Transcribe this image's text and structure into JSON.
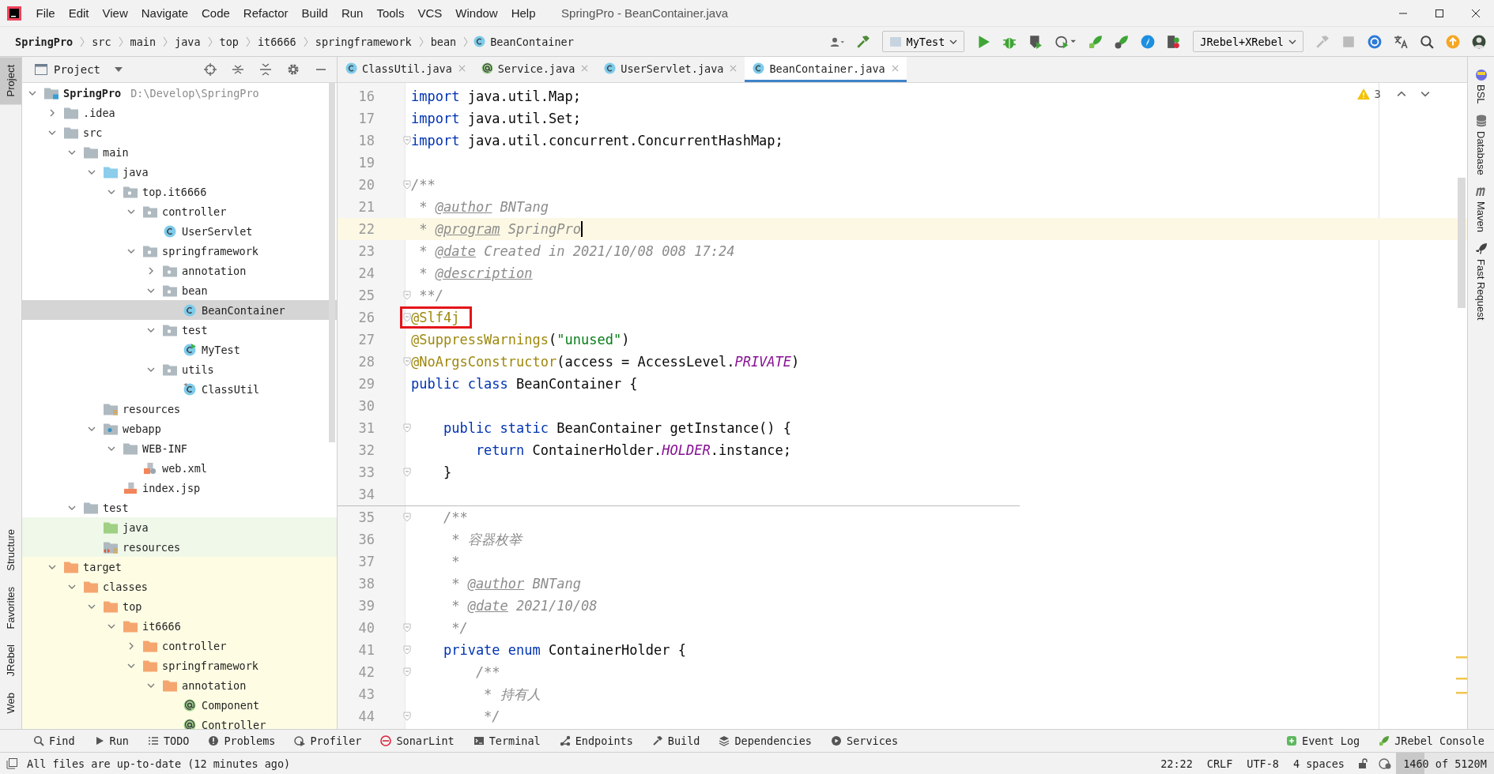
{
  "window": {
    "title": "SpringPro - BeanContainer.java"
  },
  "menu": [
    "File",
    "Edit",
    "View",
    "Navigate",
    "Code",
    "Refactor",
    "Build",
    "Run",
    "Tools",
    "VCS",
    "Window",
    "Help"
  ],
  "breadcrumbs": [
    {
      "label": "SpringPro",
      "kind": "project"
    },
    {
      "label": "src",
      "kind": "dir"
    },
    {
      "label": "main",
      "kind": "dir"
    },
    {
      "label": "java",
      "kind": "dir"
    },
    {
      "label": "top",
      "kind": "dir"
    },
    {
      "label": "it6666",
      "kind": "dir"
    },
    {
      "label": "springframework",
      "kind": "dir"
    },
    {
      "label": "bean",
      "kind": "dir"
    },
    {
      "label": "BeanContainer",
      "kind": "class"
    }
  ],
  "run_config": "MyTest",
  "rebel_config": "JRebel+XRebel",
  "left_tools": [
    {
      "label": "Project",
      "selected": true
    },
    {
      "label": "Structure",
      "selected": false
    },
    {
      "label": "Favorites",
      "selected": false
    },
    {
      "label": "JRebel",
      "selected": false
    },
    {
      "label": "Web",
      "selected": false
    }
  ],
  "right_tools": [
    "BSL",
    "Database",
    "Maven",
    "Fast Request"
  ],
  "project": {
    "title": "Project",
    "tree": [
      {
        "name": "SpringPro",
        "kind": "module",
        "hint": "D:\\Develop\\SpringPro",
        "expanded": true,
        "selected": false,
        "children": [
          {
            "name": ".idea",
            "kind": "folder",
            "expanded": false,
            "selected": false
          },
          {
            "name": "src",
            "kind": "folder",
            "expanded": true,
            "selected": false,
            "children": [
              {
                "name": "main",
                "kind": "folder",
                "expanded": true,
                "selected": false,
                "children": [
                  {
                    "name": "java",
                    "kind": "source",
                    "expanded": true,
                    "selected": false,
                    "children": [
                      {
                        "name": "top.it6666",
                        "kind": "package",
                        "expanded": true,
                        "selected": false,
                        "children": [
                          {
                            "name": "controller",
                            "kind": "package",
                            "expanded": true,
                            "selected": false,
                            "children": [
                              {
                                "name": "UserServlet",
                                "kind": "class",
                                "selected": false
                              }
                            ]
                          },
                          {
                            "name": "springframework",
                            "kind": "package",
                            "expanded": true,
                            "selected": false,
                            "children": [
                              {
                                "name": "annotation",
                                "kind": "package",
                                "expanded": false,
                                "selected": false
                              },
                              {
                                "name": "bean",
                                "kind": "package",
                                "expanded": true,
                                "selected": false,
                                "children": [
                                  {
                                    "name": "BeanContainer",
                                    "kind": "class",
                                    "selected": true
                                  }
                                ]
                              },
                              {
                                "name": "test",
                                "kind": "package",
                                "expanded": true,
                                "selected": false,
                                "children": [
                                  {
                                    "name": "MyTest",
                                    "kind": "test-class",
                                    "selected": false
                                  }
                                ]
                              },
                              {
                                "name": "utils",
                                "kind": "package",
                                "expanded": true,
                                "selected": false,
                                "children": [
                                  {
                                    "name": "ClassUtil",
                                    "kind": "util-class",
                                    "selected": false
                                  }
                                ]
                              }
                            ]
                          }
                        ]
                      }
                    ]
                  },
                  {
                    "name": "resources",
                    "kind": "resources",
                    "selected": false
                  },
                  {
                    "name": "webapp",
                    "kind": "web",
                    "expanded": true,
                    "selected": false,
                    "children": [
                      {
                        "name": "WEB-INF",
                        "kind": "folder",
                        "expanded": true,
                        "selected": false,
                        "children": [
                          {
                            "name": "web.xml",
                            "kind": "xml",
                            "selected": false
                          }
                        ]
                      },
                      {
                        "name": "index.jsp",
                        "kind": "jsp",
                        "selected": false
                      }
                    ]
                  }
                ]
              },
              {
                "name": "test",
                "kind": "folder",
                "expanded": true,
                "selected": false,
                "children": [
                  {
                    "name": "java",
                    "kind": "test-source",
                    "color": "#eff8e9",
                    "selected": false
                  },
                  {
                    "name": "resources",
                    "kind": "test-resources",
                    "color": "#eff8e9",
                    "selected": false
                  }
                ]
              }
            ]
          },
          {
            "name": "target",
            "kind": "excluded",
            "color": "#fefde4",
            "expanded": true,
            "selected": false,
            "children": [
              {
                "name": "classes",
                "kind": "excluded",
                "color": "#fefde4",
                "expanded": true,
                "selected": false,
                "children": [
                  {
                    "name": "top",
                    "kind": "excluded",
                    "color": "#fefde4",
                    "expanded": true,
                    "selected": false,
                    "children": [
                      {
                        "name": "it6666",
                        "kind": "excluded",
                        "color": "#fefde4",
                        "expanded": true,
                        "selected": false,
                        "children": [
                          {
                            "name": "controller",
                            "kind": "excluded",
                            "color": "#fefde4",
                            "expanded": false,
                            "selected": false
                          },
                          {
                            "name": "springframework",
                            "kind": "excluded",
                            "color": "#fefde4",
                            "expanded": true,
                            "selected": false,
                            "children": [
                              {
                                "name": "annotation",
                                "kind": "excluded",
                                "color": "#fefde4",
                                "expanded": true,
                                "selected": false,
                                "children": [
                                  {
                                    "name": "Component",
                                    "kind": "annotation",
                                    "color": "#fefde4",
                                    "selected": false
                                  },
                                  {
                                    "name": "Controller",
                                    "kind": "annotation",
                                    "color": "#fefde4",
                                    "selected": false
                                  }
                                ]
                              }
                            ]
                          }
                        ]
                      }
                    ]
                  }
                ]
              }
            ]
          }
        ]
      }
    ]
  },
  "tabs": [
    {
      "label": "ClassUtil.java",
      "kind": "class",
      "selected": false
    },
    {
      "label": "Service.java",
      "kind": "annotation",
      "selected": false
    },
    {
      "label": "UserServlet.java",
      "kind": "class",
      "selected": false
    },
    {
      "label": "BeanContainer.java",
      "kind": "class",
      "selected": true
    }
  ],
  "inspection": {
    "warnings": "3"
  },
  "code": {
    "lines": [
      {
        "number": "16",
        "tokens": [
          {
            "kind": "keyword",
            "text": "import"
          },
          {
            "kind": "plain",
            "text": " java.util.Map;"
          }
        ]
      },
      {
        "number": "17",
        "tokens": [
          {
            "kind": "keyword",
            "text": "import"
          },
          {
            "kind": "plain",
            "text": " java.util.Set;"
          }
        ]
      },
      {
        "number": "18",
        "fold": true,
        "tokens": [
          {
            "kind": "keyword",
            "text": "import"
          },
          {
            "kind": "plain",
            "text": " java.util.concurrent.ConcurrentHashMap;"
          }
        ]
      },
      {
        "number": "19"
      },
      {
        "number": "20",
        "fold": true,
        "tokens": [
          {
            "kind": "comment",
            "text": "/**"
          }
        ]
      },
      {
        "number": "21",
        "tokens": [
          {
            "kind": "comment",
            "text": " * "
          },
          {
            "kind": "doctag",
            "text": "@author"
          },
          {
            "kind": "comment",
            "text": " BNTang"
          }
        ]
      },
      {
        "number": "22",
        "current": true,
        "caret": true,
        "tokens": [
          {
            "kind": "comment",
            "text": " * "
          },
          {
            "kind": "doctag",
            "text": "@program"
          },
          {
            "kind": "comment",
            "text": " SpringPro"
          }
        ]
      },
      {
        "number": "23",
        "tokens": [
          {
            "kind": "comment",
            "text": " * "
          },
          {
            "kind": "doctag",
            "text": "@date"
          },
          {
            "kind": "comment",
            "text": " Created in 2021/10/08 008 17:24"
          }
        ]
      },
      {
        "number": "24",
        "tokens": [
          {
            "kind": "comment",
            "text": " * "
          },
          {
            "kind": "doctag",
            "text": "@description"
          }
        ]
      },
      {
        "number": "25",
        "fold": true,
        "tokens": [
          {
            "kind": "comment",
            "text": " **/"
          }
        ]
      },
      {
        "number": "26",
        "fold": true,
        "boxed": true,
        "tokens": [
          {
            "kind": "annotation",
            "text": "@Slf4j"
          }
        ]
      },
      {
        "number": "27",
        "tokens": [
          {
            "kind": "annotation",
            "text": "@SuppressWarnings"
          },
          {
            "kind": "plain",
            "text": "("
          },
          {
            "kind": "string",
            "text": "\"unused\""
          },
          {
            "kind": "plain",
            "text": ")"
          }
        ]
      },
      {
        "number": "28",
        "fold": true,
        "tokens": [
          {
            "kind": "annotation",
            "text": "@NoArgsConstructor"
          },
          {
            "kind": "plain",
            "text": "(access = AccessLevel."
          },
          {
            "kind": "constant",
            "text": "PRIVATE"
          },
          {
            "kind": "plain",
            "text": ")"
          }
        ]
      },
      {
        "number": "29",
        "tokens": [
          {
            "kind": "keyword",
            "text": "public class"
          },
          {
            "kind": "plain",
            "text": " BeanContainer {"
          }
        ]
      },
      {
        "number": "30"
      },
      {
        "number": "31",
        "fold": true,
        "tokens": [
          {
            "kind": "keyword",
            "text": "    public static"
          },
          {
            "kind": "plain",
            "text": " BeanContainer getInstance() {"
          }
        ]
      },
      {
        "number": "32",
        "tokens": [
          {
            "kind": "keyword",
            "text": "        return"
          },
          {
            "kind": "plain",
            "text": " ContainerHolder."
          },
          {
            "kind": "constant",
            "text": "HOLDER"
          },
          {
            "kind": "plain",
            "text": ".instance;"
          }
        ]
      },
      {
        "number": "33",
        "fold": true,
        "tokens": [
          {
            "kind": "plain",
            "text": "    }"
          }
        ]
      },
      {
        "number": "34"
      },
      {
        "number": "35",
        "fold": true,
        "separator": true,
        "tokens": [
          {
            "kind": "comment",
            "text": "    /**"
          }
        ]
      },
      {
        "number": "36",
        "tokens": [
          {
            "kind": "comment",
            "text": "     * 容器枚举"
          }
        ]
      },
      {
        "number": "37",
        "tokens": [
          {
            "kind": "comment",
            "text": "     *"
          }
        ]
      },
      {
        "number": "38",
        "tokens": [
          {
            "kind": "comment",
            "text": "     * "
          },
          {
            "kind": "doctag",
            "text": "@author"
          },
          {
            "kind": "comment",
            "text": " BNTang"
          }
        ]
      },
      {
        "number": "39",
        "tokens": [
          {
            "kind": "comment",
            "text": "     * "
          },
          {
            "kind": "doctag",
            "text": "@date"
          },
          {
            "kind": "comment",
            "text": " 2021/10/08"
          }
        ]
      },
      {
        "number": "40",
        "fold": true,
        "tokens": [
          {
            "kind": "comment",
            "text": "     */"
          }
        ]
      },
      {
        "number": "41",
        "fold": true,
        "tokens": [
          {
            "kind": "keyword",
            "text": "    private enum"
          },
          {
            "kind": "plain",
            "text": " ContainerHolder {"
          }
        ]
      },
      {
        "number": "42",
        "fold": true,
        "tokens": [
          {
            "kind": "comment",
            "text": "        /**"
          }
        ]
      },
      {
        "number": "43",
        "tokens": [
          {
            "kind": "comment",
            "text": "         * 持有人"
          }
        ]
      },
      {
        "number": "44",
        "fold": true,
        "tokens": [
          {
            "kind": "comment",
            "text": "         */"
          }
        ]
      }
    ]
  },
  "tool_buttons": [
    {
      "label": "Find",
      "kind": "search"
    },
    {
      "label": "Run",
      "kind": "run"
    },
    {
      "label": "TODO",
      "kind": "list"
    },
    {
      "label": "Problems",
      "kind": "problem"
    },
    {
      "label": "Profiler",
      "kind": "profiler"
    },
    {
      "label": "SonarLint",
      "kind": "sonar"
    },
    {
      "label": "Terminal",
      "kind": "terminal"
    },
    {
      "label": "Endpoints",
      "kind": "endpoints"
    },
    {
      "label": "Build",
      "kind": "hammer"
    },
    {
      "label": "Dependencies",
      "kind": "layers"
    },
    {
      "label": "Services",
      "kind": "services"
    }
  ],
  "right_tool_buttons": [
    {
      "label": "Event Log",
      "kind": "eventlog"
    },
    {
      "label": "JRebel Console",
      "kind": "rocket"
    }
  ],
  "status_bar": {
    "message": "All files are up-to-date (12 minutes ago)",
    "position": "22:22",
    "line_separator": "CRLF",
    "encoding": "UTF-8",
    "indent": "4 spaces",
    "memory": {
      "text": "1460 of 5120M",
      "level": 0.29
    }
  }
}
